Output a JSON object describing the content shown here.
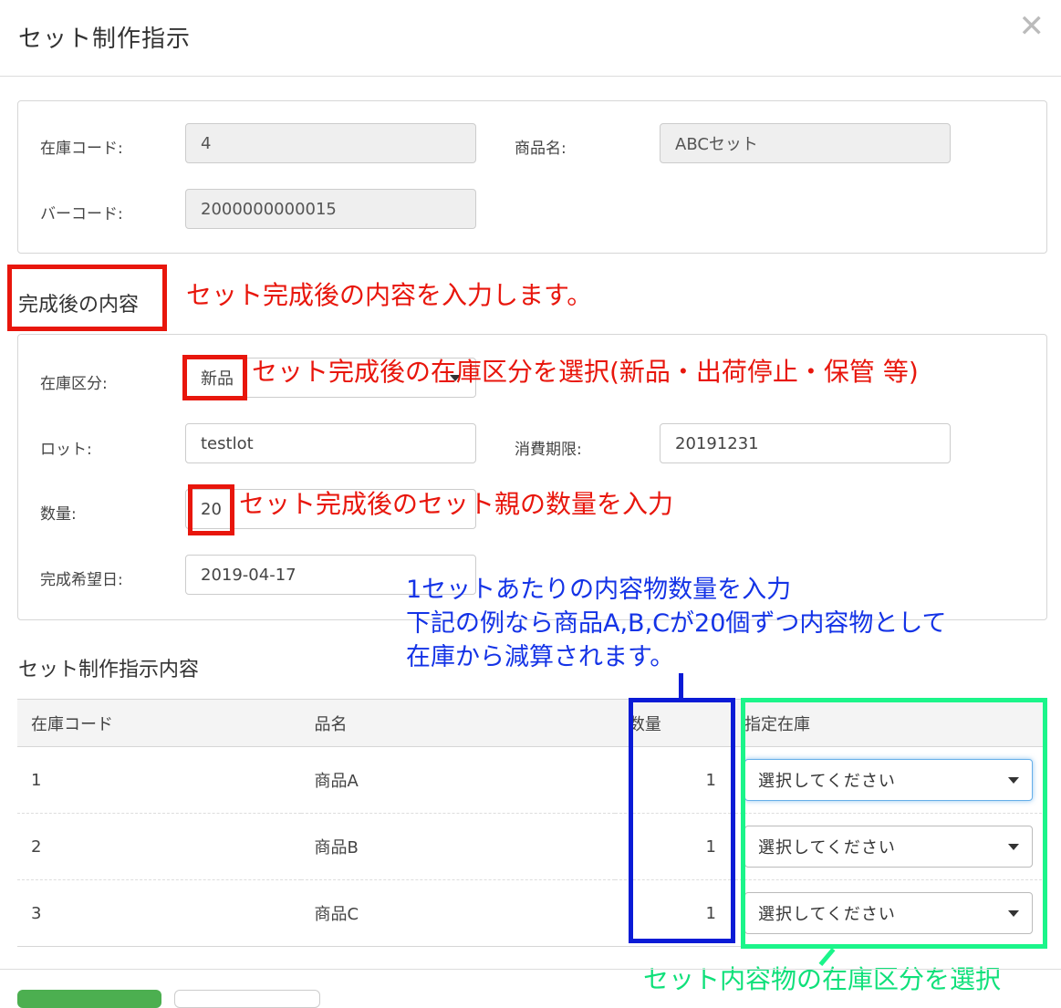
{
  "modal": {
    "title": "セット制作指示"
  },
  "info": {
    "stock_code_label": "在庫コード:",
    "stock_code_value": "4",
    "product_name_label": "商品名:",
    "product_name_value": "ABCセット",
    "barcode_label": "バーコード:",
    "barcode_value": "2000000000015"
  },
  "completed": {
    "section_title": "完成後の内容",
    "stock_category_label": "在庫区分:",
    "stock_category_value": "新品",
    "lot_label": "ロット:",
    "lot_value": "testlot",
    "expiry_label": "消費期限:",
    "expiry_value": "20191231",
    "quantity_label": "数量:",
    "quantity_value": "20",
    "desired_date_label": "完成希望日:",
    "desired_date_value": "2019-04-17"
  },
  "contents": {
    "section_title": "セット制作指示内容",
    "headers": [
      "在庫コード",
      "品名",
      "数量",
      "指定在庫"
    ],
    "rows": [
      {
        "code": "1",
        "name": "商品A",
        "qty": "1",
        "stock": "選択してください"
      },
      {
        "code": "2",
        "name": "商品B",
        "qty": "1",
        "stock": "選択してください"
      },
      {
        "code": "3",
        "name": "商品C",
        "qty": "1",
        "stock": "選択してください"
      }
    ]
  },
  "annotations": {
    "completed_note": "セット完成後の内容を入力します。",
    "category_note": "セット完成後の在庫区分を選択(新品・出荷停止・保管 等)",
    "quantity_note": "セット完成後のセット親の数量を入力",
    "per_set_line1": "1セットあたりの内容物数量を入力",
    "per_set_line2": "下記の例なら商品A,B,Cが20個ずつ内容物として",
    "per_set_line3": "在庫から減算されます。",
    "stock_note": "セット内容物の在庫区分を選択"
  },
  "colors": {
    "annotation_red": "#e8160c",
    "annotation_blue": "#1433e6",
    "annotation_green": "#0fe07a",
    "primary_button": "#4caf50"
  }
}
